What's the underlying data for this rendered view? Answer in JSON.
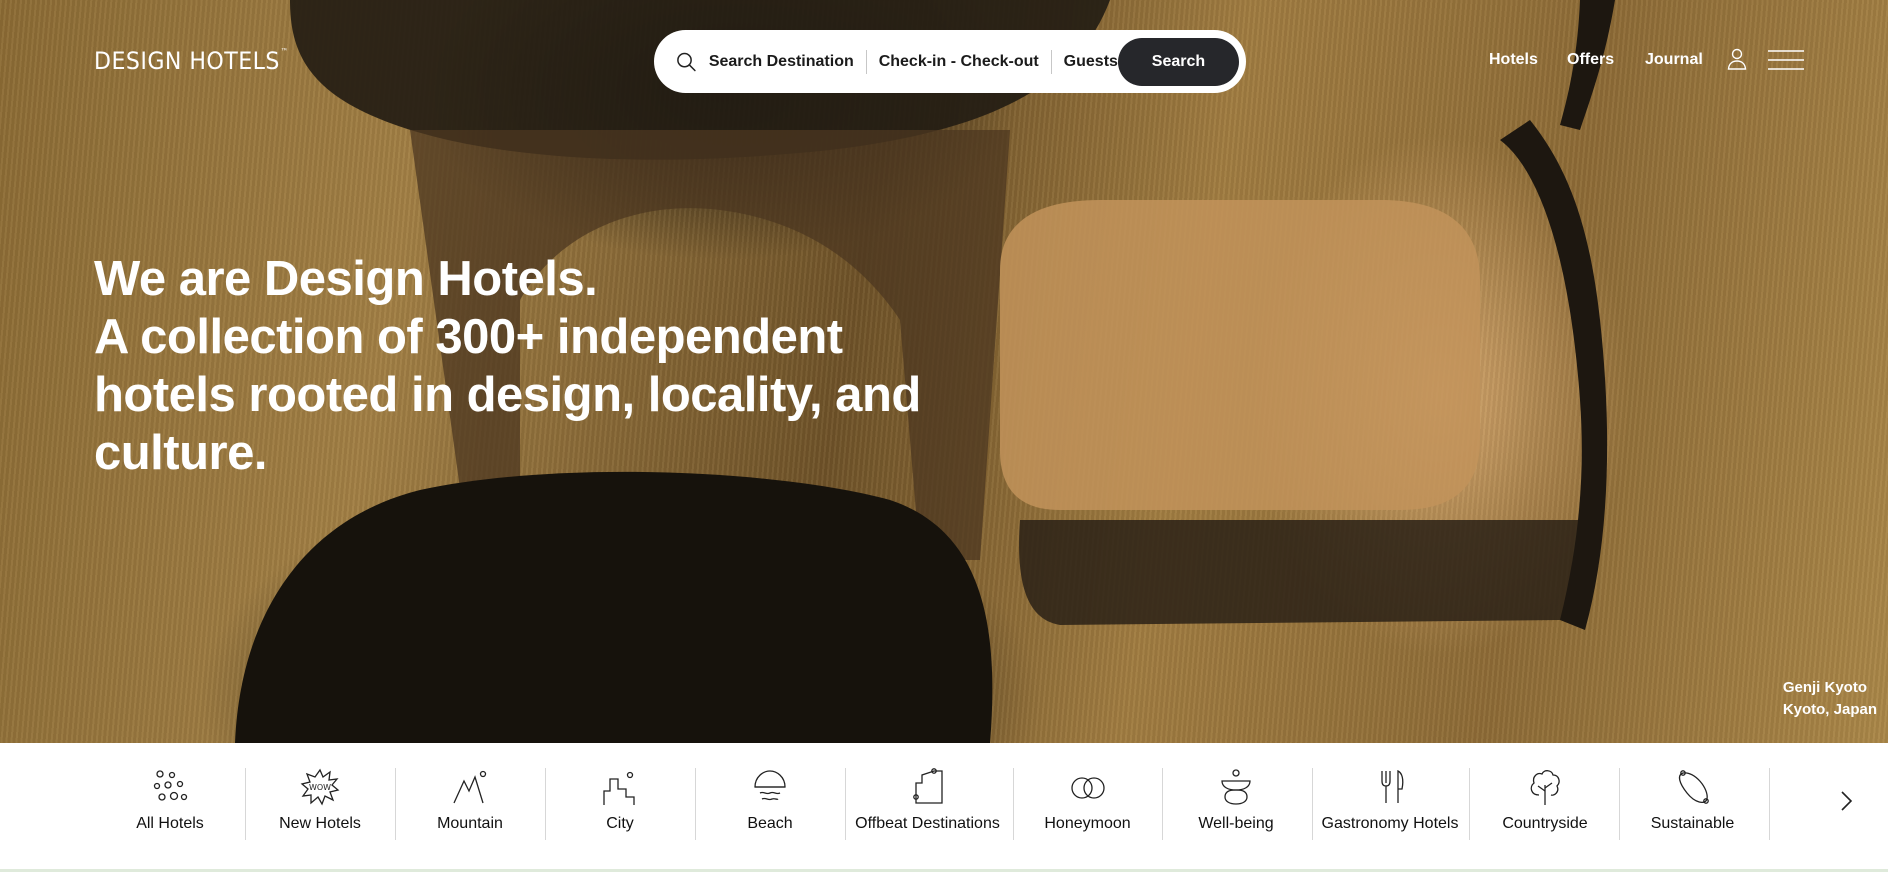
{
  "brand": {
    "name": "DESIGN HOTELS",
    "trademark": "™"
  },
  "search": {
    "destination": "Search Destination",
    "dates": "Check-in - Check-out",
    "guests": "Guests",
    "button": "Search"
  },
  "nav": {
    "hotels": "Hotels",
    "offers": "Offers",
    "journal": "Journal"
  },
  "hero": {
    "line1": "We are Design Hotels.",
    "line2": "A collection of 300+ independent",
    "line3": "hotels rooted in design, locality, and",
    "line4": "culture.",
    "caption_title": "Genji Kyoto",
    "caption_location": "Kyoto, Japan"
  },
  "categories": [
    {
      "label": "All Hotels",
      "icon": "bubbles-icon"
    },
    {
      "label": "New Hotels",
      "icon": "wow-burst-icon"
    },
    {
      "label": "Mountain",
      "icon": "mountain-icon"
    },
    {
      "label": "City",
      "icon": "city-icon"
    },
    {
      "label": "Beach",
      "icon": "beach-icon"
    },
    {
      "label": "Offbeat Destinations",
      "icon": "offbeat-icon"
    },
    {
      "label": "Honeymoon",
      "icon": "rings-icon"
    },
    {
      "label": "Well-being",
      "icon": "wellbeing-icon"
    },
    {
      "label": "Gastronomy Hotels",
      "icon": "cutlery-icon"
    },
    {
      "label": "Countryside",
      "icon": "tree-icon"
    },
    {
      "label": "Sustainable",
      "icon": "sustainable-icon"
    }
  ],
  "colors": {
    "search_button": "#26272b",
    "text_dark": "#111111",
    "white": "#ffffff"
  }
}
